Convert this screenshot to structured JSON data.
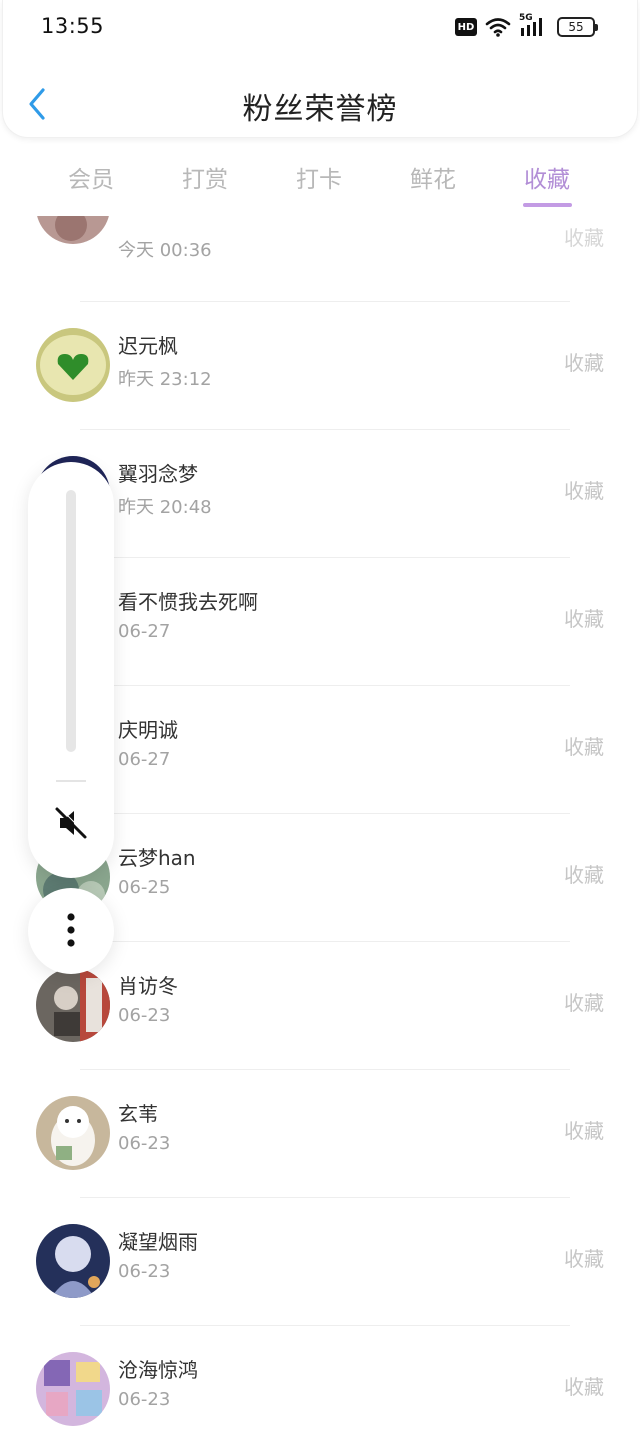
{
  "status_bar": {
    "time": "13:55",
    "hd_badge": "HD",
    "network": "5G",
    "battery": "55"
  },
  "header": {
    "title": "粉丝荣誉榜"
  },
  "tabs": [
    {
      "label": "会员",
      "active": false
    },
    {
      "label": "打赏",
      "active": false
    },
    {
      "label": "打卡",
      "active": false
    },
    {
      "label": "鲜花",
      "active": false
    },
    {
      "label": "收藏",
      "active": true
    }
  ],
  "colors": {
    "accent": "#b28ed6",
    "back_arrow": "#2f9be8"
  },
  "list": {
    "items": [
      {
        "name": "",
        "time": "今天 00:36",
        "action": "收藏"
      },
      {
        "name": "迟元枫",
        "time": "昨天 23:12",
        "action": "收藏"
      },
      {
        "name": "翼羽念梦",
        "time": "昨天 20:48",
        "action": "收藏"
      },
      {
        "name": "看不惯我去死啊",
        "time": "06-27",
        "action": "收藏"
      },
      {
        "name": "庆明诚",
        "time": "06-27",
        "action": "收藏"
      },
      {
        "name": "云梦han",
        "time": "06-25",
        "action": "收藏"
      },
      {
        "name": "肖访冬",
        "time": "06-23",
        "action": "收藏"
      },
      {
        "name": "玄苇",
        "time": "06-23",
        "action": "收藏"
      },
      {
        "name": "凝望烟雨",
        "time": "06-23",
        "action": "收藏"
      },
      {
        "name": "沧海惊鸿",
        "time": "06-23",
        "action": "收藏"
      }
    ]
  }
}
